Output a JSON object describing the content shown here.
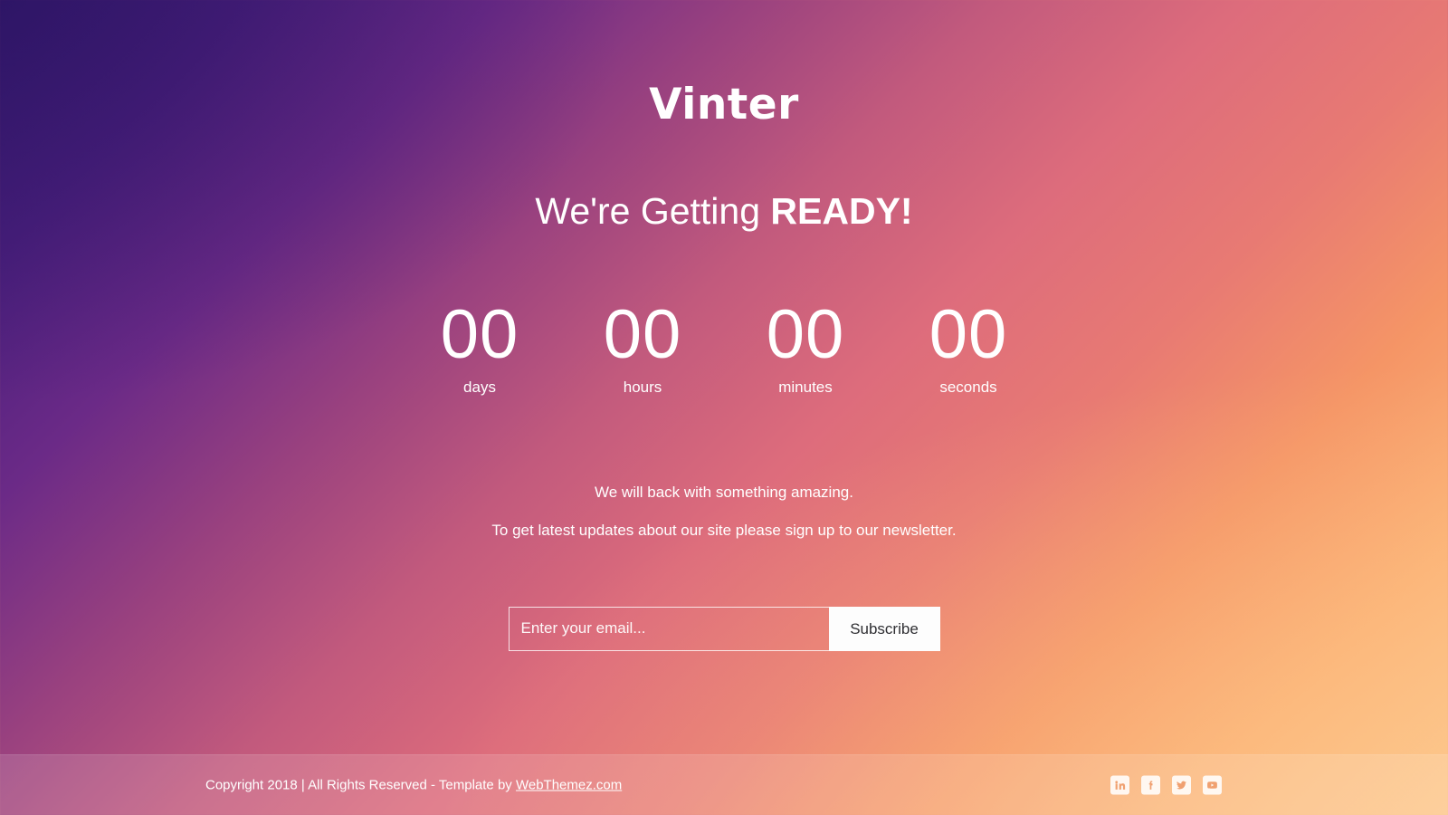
{
  "brand": {
    "logo": "Vinter"
  },
  "hero": {
    "tagline_regular": "We're Getting ",
    "tagline_strong": "READY!"
  },
  "countdown": {
    "units": [
      {
        "value": "00",
        "label": "days"
      },
      {
        "value": "00",
        "label": "hours"
      },
      {
        "value": "00",
        "label": "minutes"
      },
      {
        "value": "00",
        "label": "seconds"
      }
    ]
  },
  "copy": {
    "line1": "We will back with something amazing.",
    "line2": "To get latest updates about our site please sign up to our newsletter."
  },
  "subscribe": {
    "placeholder": "Enter your email...",
    "value": "",
    "button_label": "Subscribe"
  },
  "footer": {
    "copyright_prefix": "Copyright 2018 | All Rights Reserved - Template by ",
    "credit_link": "WebThemez.com",
    "social": [
      {
        "name": "linkedin",
        "label": "LinkedIn"
      },
      {
        "name": "facebook",
        "label": "Facebook"
      },
      {
        "name": "twitter",
        "label": "Twitter"
      },
      {
        "name": "youtube",
        "label": "YouTube"
      }
    ]
  },
  "theme": {
    "gradient_start": "#35196f",
    "gradient_mid": "#dd6c7c",
    "gradient_end": "#fdc68c",
    "text_color": "#ffffff",
    "button_bg": "#fdfdfd",
    "button_text": "#2f2f33",
    "social_icon_color": "#f0a070"
  }
}
